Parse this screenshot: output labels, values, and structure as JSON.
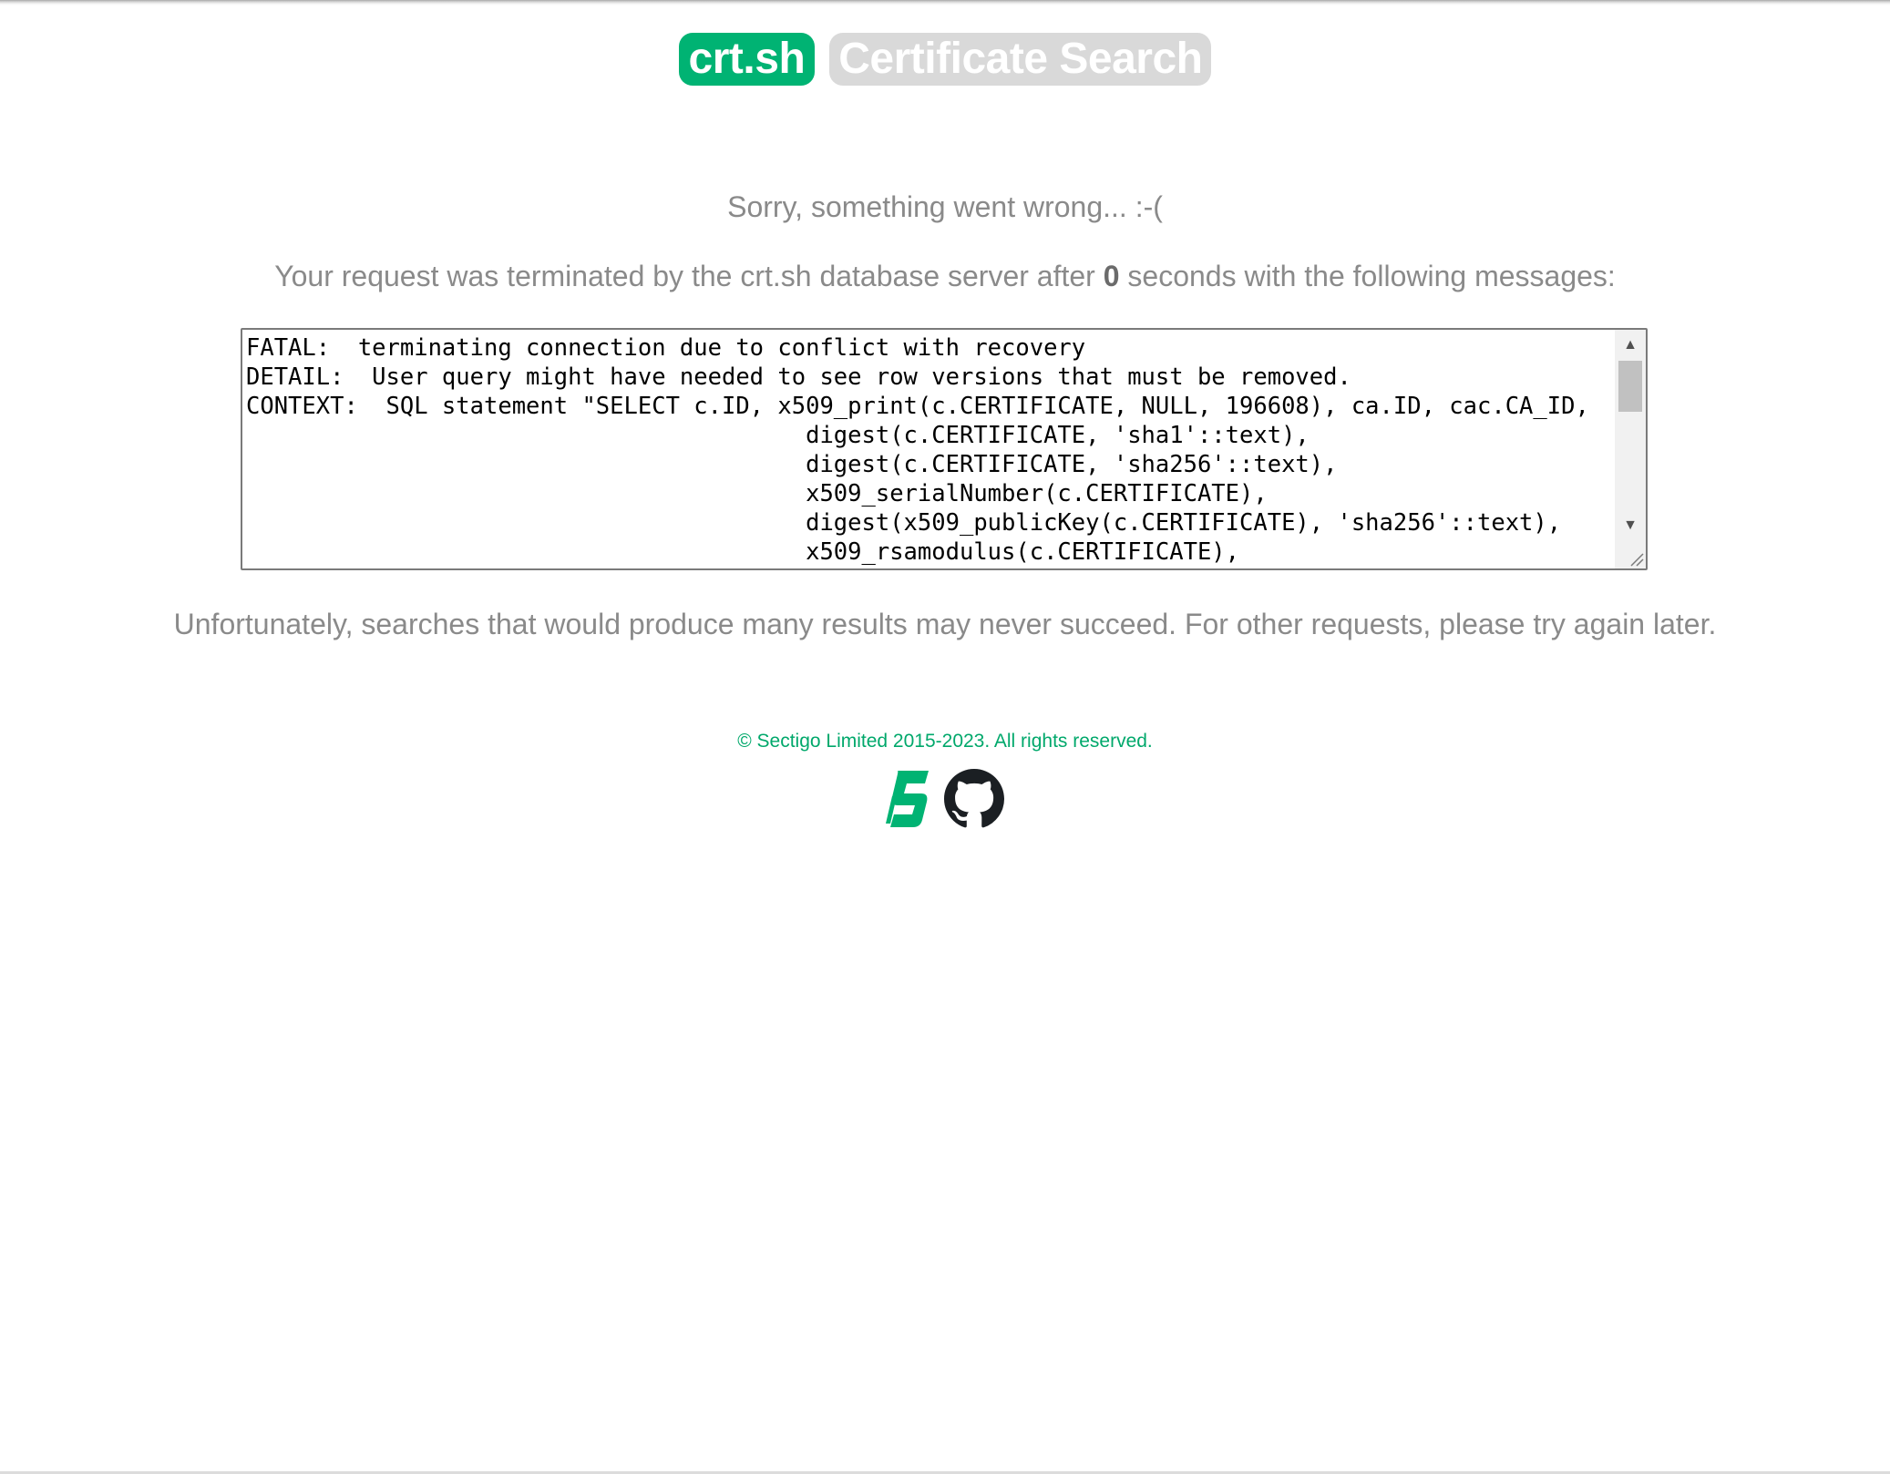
{
  "header": {
    "brand": "crt.sh",
    "title": "Certificate Search"
  },
  "error": {
    "sorry_text": "Sorry, something went wrong... :-(",
    "terminated_before": "Your request was terminated by the crt.sh database server after ",
    "seconds": "0",
    "terminated_after": " seconds with the following messages:",
    "messages": "FATAL:  terminating connection due to conflict with recovery\nDETAIL:  User query might have needed to see row versions that must be removed.\nCONTEXT:  SQL statement \"SELECT c.ID, x509_print(c.CERTIFICATE, NULL, 196608), ca.ID, cac.CA_ID,\n                                        digest(c.CERTIFICATE, 'sha1'::text),\n                                        digest(c.CERTIFICATE, 'sha256'::text),\n                                        x509_serialNumber(c.CERTIFICATE),\n                                        digest(x509_publicKey(c.CERTIFICATE), 'sha256'::text),\n                                        x509_rsamodulus(c.CERTIFICATE),",
    "advice": "Unfortunately, searches that would produce many results may never succeed. For other requests, please try again later."
  },
  "footer": {
    "copyright": "© Sectigo Limited 2015-2023. All rights reserved.",
    "icons": [
      "sectigo-logo",
      "github-icon"
    ]
  },
  "colors": {
    "brand_green": "#00b373",
    "title_gray": "#d9d9d9",
    "text_gray": "#8a8a8a",
    "footer_green": "#00a86b"
  }
}
